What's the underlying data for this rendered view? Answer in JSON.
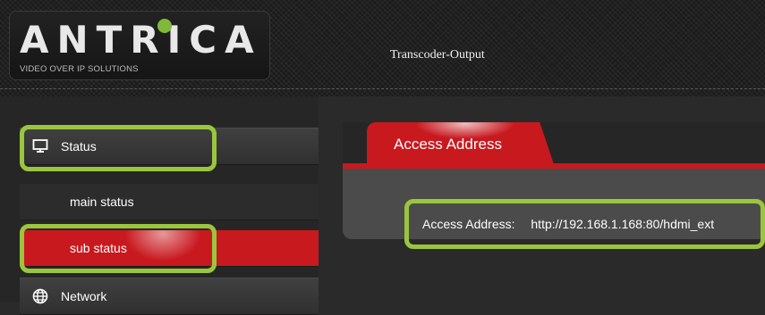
{
  "header": {
    "logo_text": "ANTRICA",
    "logo_tagline": "VIDEO OVER IP SOLUTIONS",
    "title": "Transcoder-Output"
  },
  "sidebar": {
    "items": [
      {
        "label": "Status",
        "icon": "monitor-icon",
        "type": "section"
      },
      {
        "label": "main status",
        "type": "sub"
      },
      {
        "label": "sub status",
        "type": "sub",
        "active": true
      },
      {
        "label": "Network",
        "icon": "globe-icon",
        "type": "section"
      }
    ]
  },
  "main": {
    "tab_label": "Access Address",
    "access_label": "Access Address:",
    "access_value": "http://192.168.1.168:80/hdmi_ext"
  },
  "colors": {
    "accent_red": "#c8191f",
    "highlight_green": "#9bc53d",
    "logo_dot_green": "#7fb83a"
  }
}
